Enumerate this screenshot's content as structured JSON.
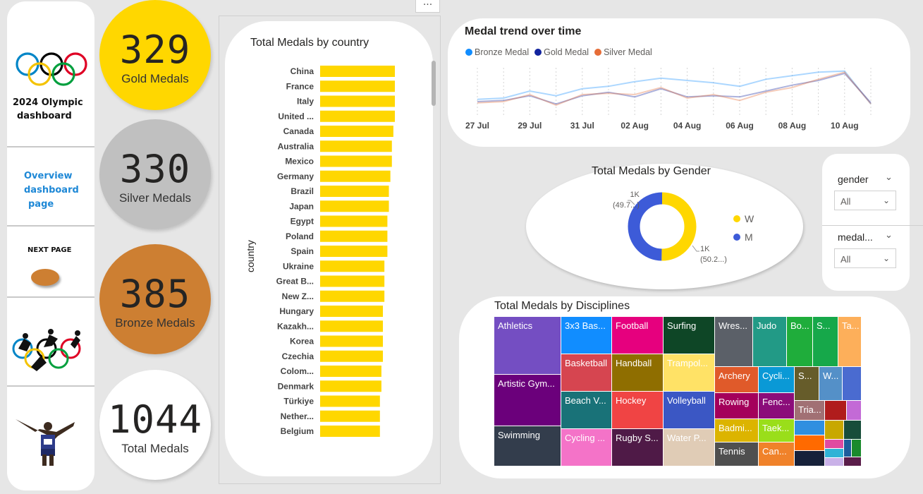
{
  "nav": {
    "title_line1": "2024 Olympic",
    "title_line2": "dashboard",
    "overview_line1": "Overview",
    "overview_line2": "dashboard",
    "overview_line3": "page",
    "next_page": "NEXT PAGE"
  },
  "kpis": [
    {
      "value": "329",
      "label": "Gold Medals",
      "color": "#ffd700"
    },
    {
      "value": "330",
      "label": "Silver Medals",
      "color": "#c0c0c0"
    },
    {
      "value": "385",
      "label": "Bronze Medals",
      "color": "#cd7f32"
    },
    {
      "value": "1044",
      "label": "Total Medals",
      "color": "#ffffff"
    }
  ],
  "colors": {
    "gold": "#ffd700",
    "bronze_line": "#cd7f32",
    "accent_blue": "#1e88d6",
    "donut_w": "#ffd700",
    "donut_m": "#3d5bd8"
  },
  "chart_data": [
    {
      "type": "bar",
      "title": "Total Medals by country",
      "ylabel": "country",
      "orientation": "horizontal",
      "categories": [
        "China",
        "France",
        "Italy",
        "United ...",
        "Canada",
        "Australia",
        "Mexico",
        "Germany",
        "Brazil",
        "Japan",
        "Egypt",
        "Poland",
        "Spain",
        "Ukraine",
        "Great B...",
        "New Z...",
        "Hungary",
        "Kazakh...",
        "Korea",
        "Czechia",
        "Colom...",
        "Denmark",
        "Türkiye",
        "Nether...",
        "Belgium"
      ],
      "values": [
        50,
        50,
        50,
        50,
        49,
        48,
        48,
        47,
        46,
        46,
        45,
        45,
        45,
        43,
        43,
        43,
        42,
        42,
        42,
        42,
        41,
        41,
        40,
        40,
        40
      ],
      "grid": false
    },
    {
      "type": "line",
      "title": "Medal trend over time",
      "x": [
        "27 Jul",
        "28 Jul",
        "29 Jul",
        "30 Jul",
        "31 Jul",
        "01 Aug",
        "02 Aug",
        "03 Aug",
        "04 Aug",
        "05 Aug",
        "06 Aug",
        "07 Aug",
        "08 Aug",
        "09 Aug",
        "10 Aug",
        "11 Aug"
      ],
      "x_ticks": [
        "27 Jul",
        "29 Jul",
        "31 Jul",
        "02 Aug",
        "04 Aug",
        "06 Aug",
        "08 Aug",
        "10 Aug"
      ],
      "legend_position": "top-left",
      "series": [
        {
          "name": "Bronze Medal",
          "color": "#118dff",
          "values": [
            24,
            25,
            31,
            27,
            33,
            35,
            39,
            42,
            40,
            38,
            35,
            41,
            44,
            47,
            48,
            20
          ]
        },
        {
          "name": "Gold Medal",
          "color": "#12239e",
          "values": [
            22,
            23,
            27,
            20,
            27,
            30,
            26,
            33,
            26,
            27,
            26,
            31,
            36,
            40,
            46,
            21
          ]
        },
        {
          "name": "Silver Medal",
          "color": "#e66c37",
          "values": [
            21,
            22,
            28,
            19,
            28,
            29,
            28,
            34,
            25,
            28,
            23,
            30,
            34,
            41,
            47,
            20
          ]
        }
      ]
    },
    {
      "type": "pie",
      "title": "Total Medals by Gender",
      "donut": true,
      "labels": [
        "W",
        "M"
      ],
      "values": [
        50.2,
        49.7
      ],
      "data_labels": [
        {
          "value": "1K",
          "pct": "(50.2...)"
        },
        {
          "value": "1K",
          "pct": "(49.7...)"
        }
      ],
      "legend_position": "right"
    },
    {
      "type": "treemap",
      "title": "Total Medals by Disciplines",
      "items": [
        {
          "label": "Athletics",
          "color": "#744ec2"
        },
        {
          "label": "Artistic Gym...",
          "color": "#6b007b"
        },
        {
          "label": "Swimming",
          "color": "#333d4c"
        },
        {
          "label": "3x3 Bas...",
          "color": "#118dff"
        },
        {
          "label": "Basketball",
          "color": "#d64550"
        },
        {
          "label": "Beach V...",
          "color": "#197278"
        },
        {
          "label": "Cycling ...",
          "color": "#f473c8"
        },
        {
          "label": "Football",
          "color": "#e6007e"
        },
        {
          "label": "Handball",
          "color": "#8f6e00"
        },
        {
          "label": "Hockey",
          "color": "#f04444"
        },
        {
          "label": "Rugby S...",
          "color": "#4f1a47"
        },
        {
          "label": "Surfing",
          "color": "#0e4626"
        },
        {
          "label": "Trampol...",
          "color": "#ffe266"
        },
        {
          "label": "Volleyball",
          "color": "#3b57c4"
        },
        {
          "label": "Water P...",
          "color": "#e0ccb6"
        },
        {
          "label": "Wres...",
          "color": "#5b6068"
        },
        {
          "label": "Judo",
          "color": "#229a86"
        },
        {
          "label": "Bo...",
          "color": "#1fad3b"
        },
        {
          "label": "S...",
          "color": "#16a84a"
        },
        {
          "label": "Ta...",
          "color": "#fdaf5a"
        },
        {
          "label": "Archery",
          "color": "#e05a2a"
        },
        {
          "label": "Cycli...",
          "color": "#0a99d6"
        },
        {
          "label": "S...",
          "color": "#665c2a"
        },
        {
          "label": "W...",
          "color": "#5490c8"
        },
        {
          "label": "Rowing",
          "color": "#a4005b"
        },
        {
          "label": "Fenc...",
          "color": "#8b0d7a"
        },
        {
          "label": "Tria...",
          "color": "#a17074"
        },
        {
          "label": "Badmi...",
          "color": "#dcb400"
        },
        {
          "label": "Taek...",
          "color": "#9ade1a"
        },
        {
          "label": "Tennis",
          "color": "#4f4f4f"
        },
        {
          "label": "Can...",
          "color": "#f0822a"
        }
      ]
    }
  ],
  "filters": [
    {
      "label": "gender",
      "value": "All"
    },
    {
      "label": "medal...",
      "value": "All"
    }
  ],
  "more_options": "..."
}
